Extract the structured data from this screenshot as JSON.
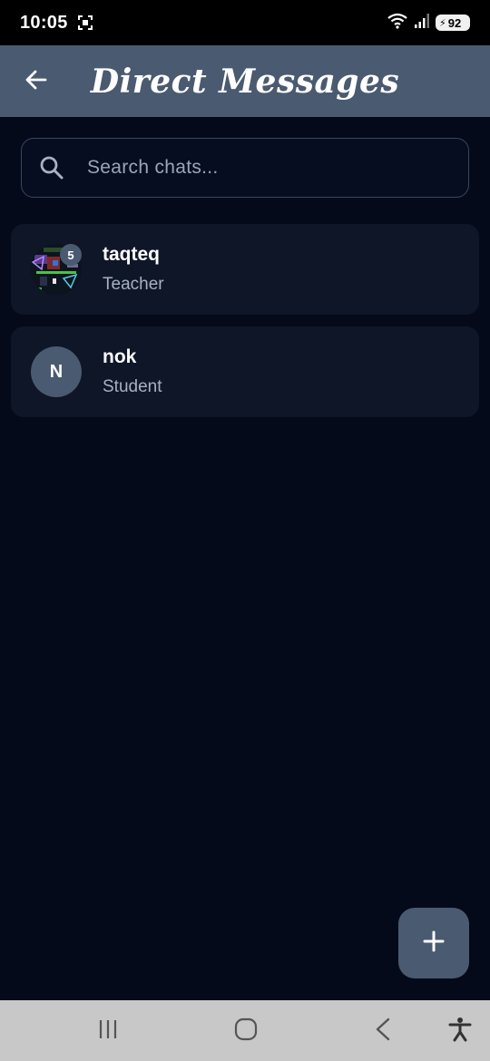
{
  "status_bar": {
    "time": "10:05",
    "battery": "92",
    "icons": [
      "screenshot-icon",
      "wifi-icon",
      "signal-icon",
      "battery-icon"
    ]
  },
  "app_bar": {
    "title": "Direct Messages",
    "back_icon": "arrow-left-icon",
    "background": "#4a5a70"
  },
  "search": {
    "placeholder": "Search chats...",
    "value": "",
    "icon": "search-icon"
  },
  "chats": [
    {
      "name": "taqteq",
      "role": "Teacher",
      "avatar_type": "image",
      "unread": "5"
    },
    {
      "name": "nok",
      "role": "Student",
      "avatar_type": "letter",
      "avatar_letter": "N"
    }
  ],
  "fab": {
    "icon": "plus-icon"
  },
  "nav": {
    "icons": [
      "recent-apps-icon",
      "home-icon",
      "back-icon",
      "accessibility-icon"
    ]
  },
  "colors": {
    "background": "#050a1a",
    "card": "#0e1627",
    "accent": "#4a5a70"
  }
}
